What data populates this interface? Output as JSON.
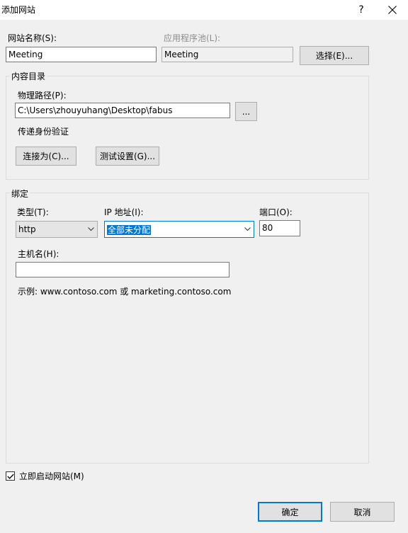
{
  "window": {
    "title": "添加网站",
    "help_label": "?",
    "close_icon": "close-icon"
  },
  "site": {
    "name_label": "网站名称(S):",
    "name_value": "Meeting",
    "pool_label": "应用程序池(L):",
    "pool_value": "Meeting",
    "select_button": "选择(E)..."
  },
  "content": {
    "group_title": "内容目录",
    "path_label": "物理路径(P):",
    "path_value": "C:\\Users\\zhouyuhang\\Desktop\\fabus",
    "browse_button": "...",
    "auth_label": "传递身份验证",
    "connect_button": "连接为(C)...",
    "test_button": "测试设置(G)..."
  },
  "binding": {
    "group_title": "绑定",
    "type_label": "类型(T):",
    "type_value": "http",
    "ip_label": "IP 地址(I):",
    "ip_value": "全部未分配",
    "port_label": "端口(O):",
    "port_value": "80",
    "host_label": "主机名(H):",
    "host_value": "",
    "example_text": "示例: www.contoso.com 或 marketing.contoso.com"
  },
  "start_now": {
    "label": "立即启动网站(M)",
    "checked": true
  },
  "footer": {
    "ok_button": "确定",
    "cancel_button": "取消"
  },
  "colors": {
    "accent": "#0078d7",
    "background": "#f0f0f0"
  }
}
